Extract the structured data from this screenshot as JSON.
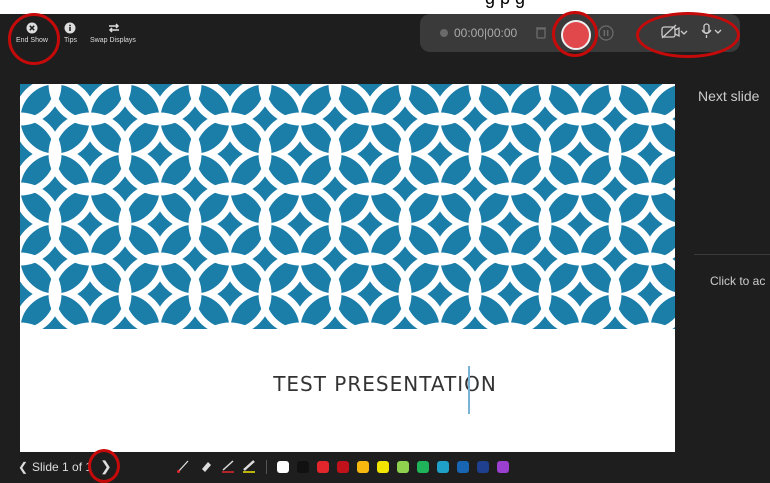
{
  "app": {
    "caption_fragment": "g    p    g"
  },
  "toolbar": {
    "end_show": "End Show",
    "tips": "Tips",
    "swap_displays": "Swap Displays"
  },
  "recording": {
    "timer": "00:00|00:00"
  },
  "slide": {
    "title": "TEST PRESENTATION"
  },
  "panel": {
    "next_slide": "Next slide",
    "notes_placeholder": "Click to ac"
  },
  "navigation": {
    "slide_counter": "Slide 1 of 1"
  },
  "colors": {
    "swatches": [
      "#ffffff",
      "#111111",
      "#e3262b",
      "#c1121b",
      "#f6b80f",
      "#f1e500",
      "#8fd14f",
      "#1fb35a",
      "#1ea0c8",
      "#1866b3",
      "#1f3f8f",
      "#9b3fd1"
    ],
    "highlight": "#c60a0a",
    "pattern_blue": "#1b7ea9"
  }
}
